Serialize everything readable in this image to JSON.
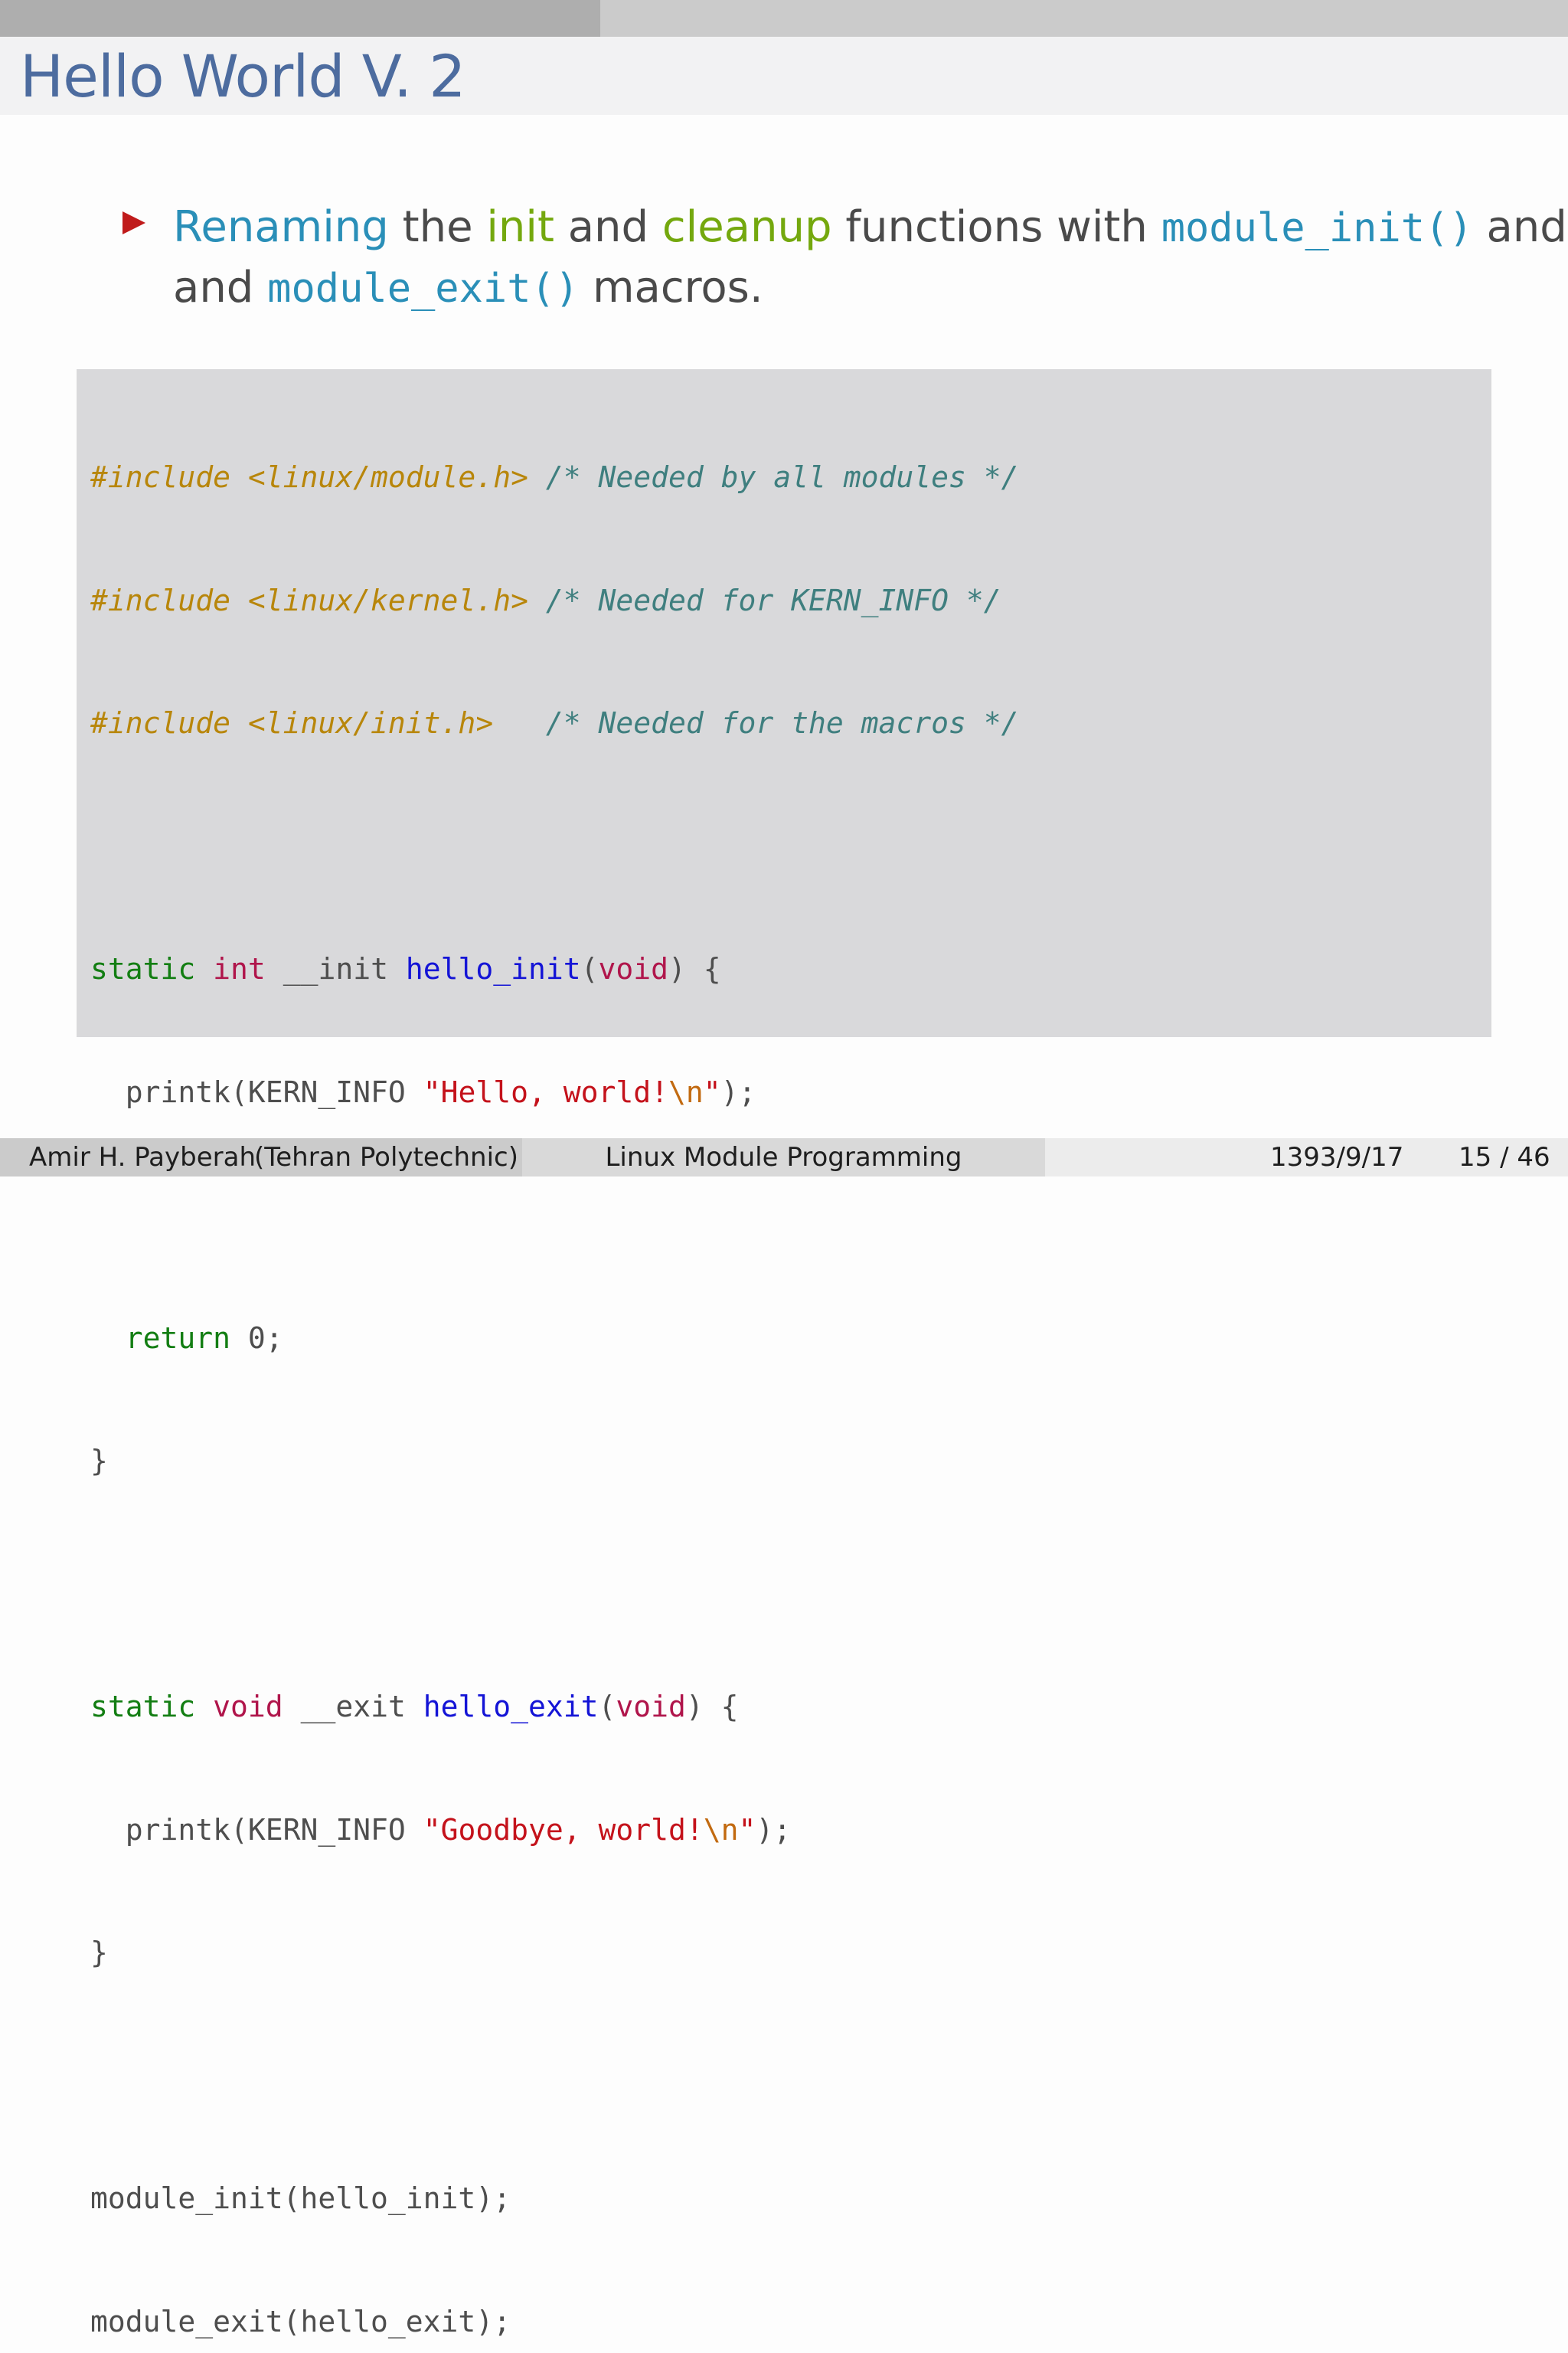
{
  "progress": {
    "fraction": 0.383
  },
  "frame_title": "Hello World V. 2",
  "bullet": {
    "seg1": "Renaming",
    "seg2": " the ",
    "seg3": "init",
    "seg4": " and ",
    "seg5": "cleanup",
    "seg6": " functions with ",
    "seg7": "module_init()",
    "seg8": " and",
    "seg9": "and ",
    "seg10": "module_exit()",
    "seg11": " macros."
  },
  "code": {
    "l1": {
      "pp": "#include <linux/module.h>",
      "sp": " ",
      "cm": "/* Needed by all modules */"
    },
    "l2": {
      "pp": "#include <linux/kernel.h>",
      "sp": " ",
      "cm": "/* Needed for KERN_INFO */"
    },
    "l3": {
      "pp": "#include <linux/init.h>",
      "sp": "   ",
      "cm": "/* Needed for the macros */"
    },
    "l5": {
      "kw": "static",
      "sp1": " ",
      "ty": "int",
      "p1": " __init ",
      "fn": "hello_init",
      "p2": "(",
      "ty2": "void",
      "p3": ") {"
    },
    "l6": {
      "p1": "  printk(KERN_INFO ",
      "st1": "\"Hello, world!",
      "es": "\\n",
      "st2": "\"",
      "p2": ");"
    },
    "l8": {
      "p0": "  ",
      "kw": "return",
      "p1": " 0;"
    },
    "l9": {
      "p": "}"
    },
    "l11": {
      "kw": "static",
      "sp1": " ",
      "ty": "void",
      "p1": " __exit ",
      "fn": "hello_exit",
      "p2": "(",
      "ty2": "void",
      "p3": ") {"
    },
    "l12": {
      "p1": "  printk(KERN_INFO ",
      "st1": "\"Goodbye, world!",
      "es": "\\n",
      "st2": "\"",
      "p2": ");"
    },
    "l13": {
      "p": "}"
    },
    "l15": {
      "p": "module_init(hello_init);"
    },
    "l16": {
      "p": "module_exit(hello_exit);"
    }
  },
  "footer": {
    "author": "Amir H. Payberah",
    "institution": "(Tehran Polytechnic)",
    "title": "Linux Module Programming",
    "date": "1393/9/17",
    "page": "15 / 46"
  },
  "colors": {
    "title": "#4d6c9f",
    "bullet_marker": "#c01b1b",
    "highlight_blue": "#2a8fb8",
    "highlight_green": "#74a80e",
    "code_background": "#d9d9db"
  }
}
